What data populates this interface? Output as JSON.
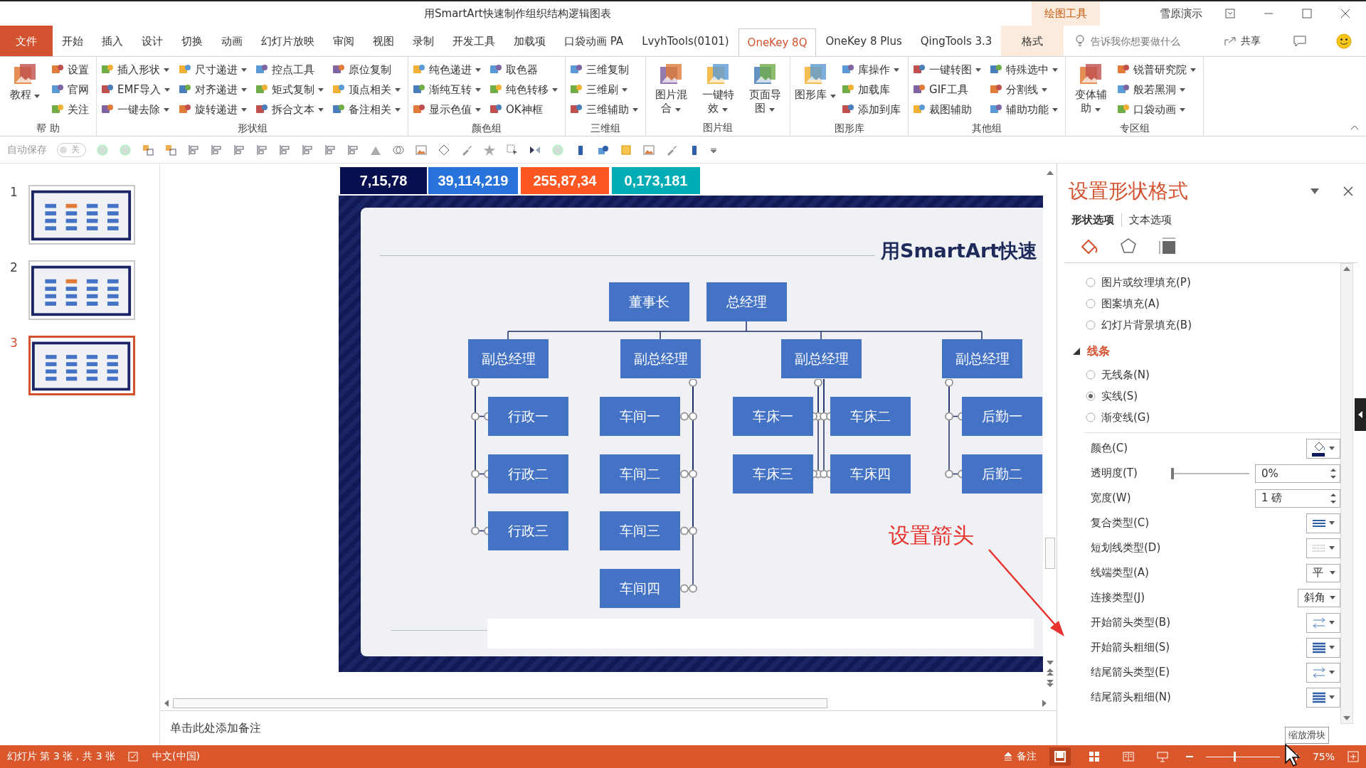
{
  "window": {
    "title": "用SmartArt快速制作组织结构逻辑图表",
    "context_group": "绘图工具",
    "user": "雪原演示"
  },
  "tabs": [
    {
      "label": "文件",
      "kind": "file",
      "selected": false
    },
    {
      "label": "开始",
      "kind": "normal",
      "selected": false
    },
    {
      "label": "插入",
      "kind": "normal",
      "selected": false
    },
    {
      "label": "设计",
      "kind": "normal",
      "selected": false
    },
    {
      "label": "切换",
      "kind": "normal",
      "selected": false
    },
    {
      "label": "动画",
      "kind": "normal",
      "selected": false
    },
    {
      "label": "幻灯片放映",
      "kind": "normal",
      "selected": false
    },
    {
      "label": "审阅",
      "kind": "normal",
      "selected": false
    },
    {
      "label": "视图",
      "kind": "normal",
      "selected": false
    },
    {
      "label": "录制",
      "kind": "normal",
      "selected": false
    },
    {
      "label": "开发工具",
      "kind": "normal",
      "selected": false
    },
    {
      "label": "加载项",
      "kind": "normal",
      "selected": false
    },
    {
      "label": "口袋动画 PA",
      "kind": "normal",
      "selected": false
    },
    {
      "label": "LvyhTools(0101)",
      "kind": "normal",
      "selected": false
    },
    {
      "label": "OneKey 8Q",
      "kind": "normal",
      "selected": true
    },
    {
      "label": "OneKey 8 Plus",
      "kind": "normal",
      "selected": false
    },
    {
      "label": "QingTools 3.3",
      "kind": "normal",
      "selected": false
    },
    {
      "label": "格式",
      "kind": "context",
      "selected": false
    }
  ],
  "tell_me": {
    "placeholder": "告诉我你想要做什么"
  },
  "share": "共享",
  "ribbon": {
    "groups": [
      {
        "label": "帮 助",
        "items": [
          {
            "label": "教程",
            "kind": "large",
            "dropdown": true
          },
          {
            "label": "设置",
            "kind": "small",
            "dropdown": false
          },
          {
            "label": "官网",
            "kind": "small",
            "dropdown": false
          },
          {
            "label": "关注",
            "kind": "small",
            "dropdown": false
          }
        ]
      },
      {
        "label": "形状组",
        "items": [
          {
            "label": "插入形状",
            "kind": "small",
            "dropdown": true
          },
          {
            "label": "EMF导入",
            "kind": "small",
            "dropdown": true
          },
          {
            "label": "一键去除",
            "kind": "small",
            "dropdown": true
          },
          {
            "label": "尺寸递进",
            "kind": "small",
            "dropdown": true
          },
          {
            "label": "对齐递进",
            "kind": "small",
            "dropdown": true
          },
          {
            "label": "旋转递进",
            "kind": "small",
            "dropdown": true
          },
          {
            "label": "控点工具",
            "kind": "small",
            "dropdown": false
          },
          {
            "label": "矩式复制",
            "kind": "small",
            "dropdown": true
          },
          {
            "label": "拆合文本",
            "kind": "small",
            "dropdown": true
          },
          {
            "label": "原位复制",
            "kind": "small",
            "dropdown": false
          },
          {
            "label": "顶点相关",
            "kind": "small",
            "dropdown": true
          },
          {
            "label": "备注相关",
            "kind": "small",
            "dropdown": true
          }
        ]
      },
      {
        "label": "颜色组",
        "items": [
          {
            "label": "纯色递进",
            "kind": "small",
            "dropdown": true
          },
          {
            "label": "渐纯互转",
            "kind": "small",
            "dropdown": true
          },
          {
            "label": "显示色值",
            "kind": "small",
            "dropdown": true
          },
          {
            "label": "取色器",
            "kind": "small",
            "dropdown": false
          },
          {
            "label": "纯色转移",
            "kind": "small",
            "dropdown": true
          },
          {
            "label": "OK神框",
            "kind": "small",
            "dropdown": false
          }
        ]
      },
      {
        "label": "三维组",
        "items": [
          {
            "label": "三维复制",
            "kind": "small",
            "dropdown": false
          },
          {
            "label": "三维刷",
            "kind": "small",
            "dropdown": true
          },
          {
            "label": "三维辅助",
            "kind": "small",
            "dropdown": true
          }
        ]
      },
      {
        "label": "图片组",
        "items": [
          {
            "label": "图片混合",
            "kind": "large",
            "dropdown": true
          },
          {
            "label": "一键特效",
            "kind": "large",
            "dropdown": true
          },
          {
            "label": "页面导图",
            "kind": "large",
            "dropdown": true
          }
        ]
      },
      {
        "label": "图形库",
        "items": [
          {
            "label": "图形库",
            "kind": "large",
            "dropdown": true
          },
          {
            "label": "库操作",
            "kind": "small",
            "dropdown": true
          },
          {
            "label": "加载库",
            "kind": "small",
            "dropdown": false
          },
          {
            "label": "添加到库",
            "kind": "small",
            "dropdown": false
          }
        ]
      },
      {
        "label": "其他组",
        "items": [
          {
            "label": "一键转图",
            "kind": "small",
            "dropdown": true
          },
          {
            "label": "GIF工具",
            "kind": "small",
            "dropdown": false
          },
          {
            "label": "裁图辅助",
            "kind": "small",
            "dropdown": false
          },
          {
            "label": "特殊选中",
            "kind": "small",
            "dropdown": true
          },
          {
            "label": "分割线",
            "kind": "small",
            "dropdown": true
          },
          {
            "label": "辅助功能",
            "kind": "small",
            "dropdown": true
          }
        ]
      },
      {
        "label": "专区组",
        "items": [
          {
            "label": "变体辅助",
            "kind": "large",
            "dropdown": true
          },
          {
            "label": "锐普研究院",
            "kind": "small",
            "dropdown": true
          },
          {
            "label": "般若黑洞",
            "kind": "small",
            "dropdown": true
          },
          {
            "label": "口袋动画",
            "kind": "small",
            "dropdown": true
          }
        ]
      }
    ]
  },
  "quick_toolbar": {
    "autosave": {
      "label": "自动保存",
      "on": false,
      "state_text": "关"
    }
  },
  "slides": [
    {
      "number": "1",
      "selected": false
    },
    {
      "number": "2",
      "selected": false
    },
    {
      "number": "3",
      "selected": true
    }
  ],
  "slide": {
    "color_chips": [
      {
        "label": "7,15,78",
        "color": "#070f4e"
      },
      {
        "label": "39,114,219",
        "color": "#2772db"
      },
      {
        "label": "255,87,34",
        "color": "#ff5722"
      },
      {
        "label": "0,173,181",
        "color": "#00adb5"
      }
    ],
    "title": "用SmartArt快速",
    "org_chart": {
      "top": [
        {
          "label": "董事长"
        },
        {
          "label": "总经理"
        }
      ],
      "branches": [
        {
          "label": "副总经理",
          "kind": "right",
          "children": [
            {
              "label": "行政一"
            },
            {
              "label": "行政二"
            },
            {
              "label": "行政三"
            }
          ]
        },
        {
          "label": "副总经理",
          "kind": "left",
          "children": [
            {
              "label": "车间一"
            },
            {
              "label": "车间二"
            },
            {
              "label": "车间三"
            },
            {
              "label": "车间四"
            }
          ]
        },
        {
          "label": "副总经理",
          "kind": "split",
          "children": [
            {
              "label": "车床一"
            },
            {
              "label": "车床二"
            },
            {
              "label": "车床三"
            },
            {
              "label": "车床四"
            }
          ]
        },
        {
          "label": "副总经理",
          "kind": "right",
          "children": [
            {
              "label": "后勤一"
            },
            {
              "label": "后勤二"
            }
          ]
        }
      ]
    },
    "annotation": "设置箭头"
  },
  "notes": {
    "placeholder": "单击此处添加备注"
  },
  "format_panel": {
    "title": "设置形状格式",
    "tabs": [
      {
        "label": "形状选项",
        "selected": true
      },
      {
        "label": "文本选项",
        "selected": false
      }
    ],
    "icon_tabs": [
      {
        "kind": "fill",
        "selected": true
      },
      {
        "kind": "effects",
        "selected": false
      },
      {
        "kind": "size",
        "selected": false
      }
    ],
    "fill_options": [
      {
        "label": "图片或纹理填充(P)",
        "selected": false
      },
      {
        "label": "图案填充(A)",
        "selected": false
      },
      {
        "label": "幻灯片背景填充(B)",
        "selected": false
      }
    ],
    "line_section": {
      "label": "线条",
      "expanded": true,
      "options": [
        {
          "label": "无线条(N)",
          "selected": false
        },
        {
          "label": "实线(S)",
          "selected": true
        },
        {
          "label": "渐变线(G)",
          "selected": false
        }
      ],
      "properties": [
        {
          "label": "颜色(C)",
          "kind": "color",
          "color": "#0d1a5c"
        },
        {
          "label": "透明度(T)",
          "kind": "slider",
          "level": 0,
          "value": "0%"
        },
        {
          "label": "宽度(W)",
          "kind": "spin",
          "value": "1 磅"
        },
        {
          "label": "复合类型(C)",
          "kind": "compound"
        },
        {
          "label": "短划线类型(D)",
          "kind": "dash"
        },
        {
          "label": "线端类型(A)",
          "kind": "select",
          "value": "平"
        },
        {
          "label": "连接类型(J)",
          "kind": "select",
          "value": "斜角"
        },
        {
          "label": "开始箭头类型(B)",
          "kind": "arrow_type"
        },
        {
          "label": "开始箭头粗细(S)",
          "kind": "arrow_size"
        },
        {
          "label": "结尾箭头类型(E)",
          "kind": "arrow_type"
        },
        {
          "label": "结尾箭头粗细(N)",
          "kind": "arrow_size"
        }
      ]
    }
  },
  "status_bar": {
    "slide_info": "幻灯片 第 3 张，共 3 张",
    "language": "中文(中国)",
    "notes": "备注",
    "views": [
      {
        "kind": "normal",
        "selected": true
      },
      {
        "kind": "sorter",
        "selected": false
      },
      {
        "kind": "reading",
        "selected": false
      },
      {
        "kind": "slideshow",
        "selected": false
      }
    ],
    "zoom": {
      "level": 0.38,
      "reading": "75%"
    },
    "tooltip": "缩放滑块"
  }
}
